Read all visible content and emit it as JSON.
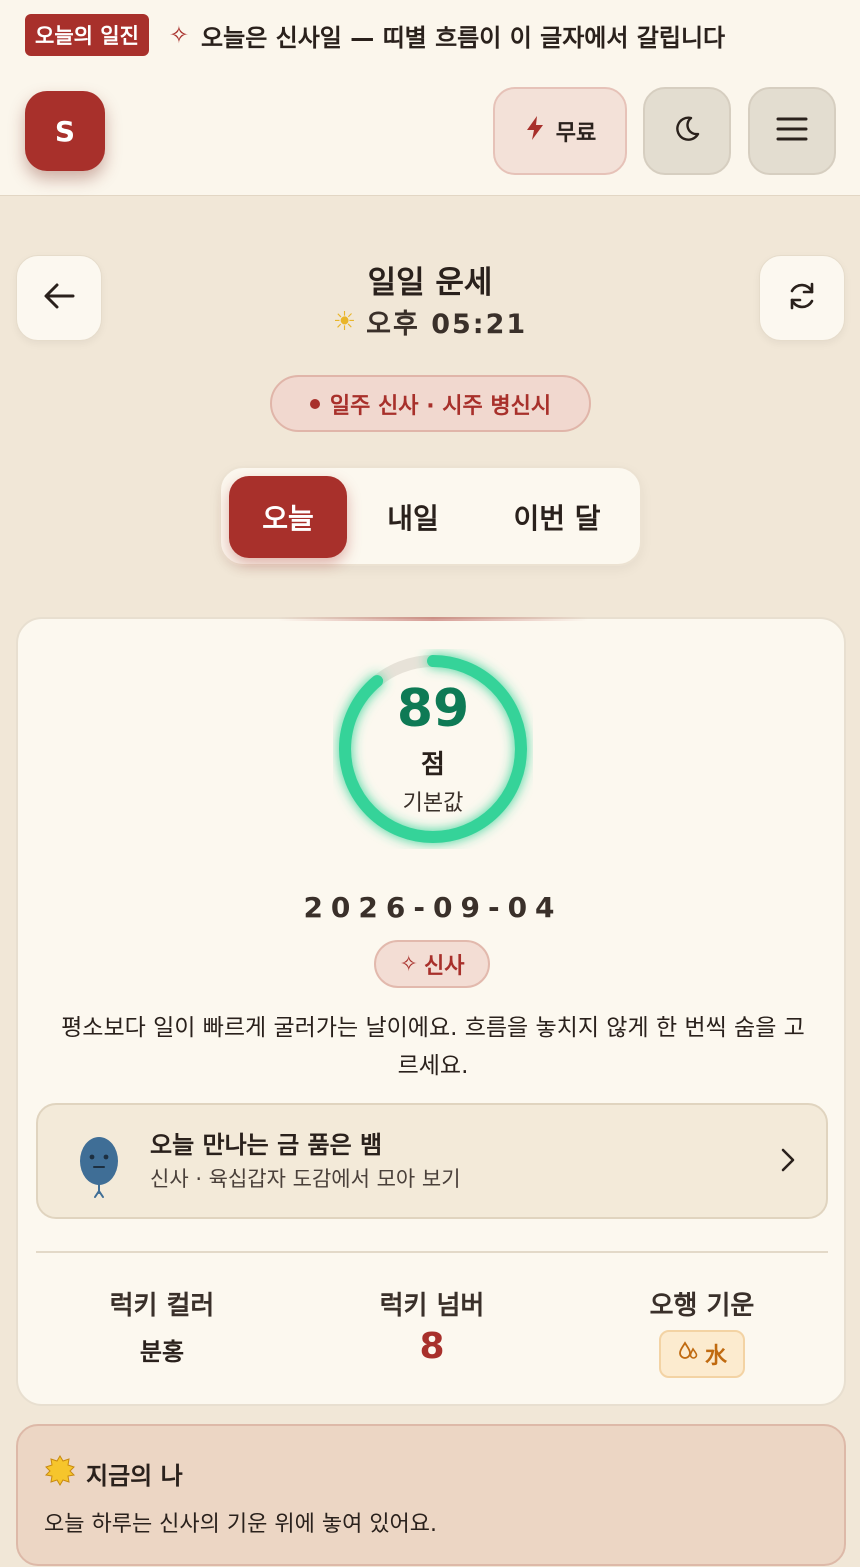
{
  "ticker": {
    "badge": "오늘의 일진",
    "icon": "sparkle-icon",
    "text": "오늘은 신사일 — 띠별 흐름이 이 글자에서 갈립니다"
  },
  "header": {
    "logo": "S",
    "free_label": "무료",
    "free_icon": "bolt-icon",
    "theme_icon": "moon-icon",
    "menu_icon": "hamburger-menu-icon"
  },
  "page": {
    "title": "일일 운세",
    "time": "오후 05:21",
    "time_icon": "sun-icon"
  },
  "pillar_badge": "일주 신사 · 시주 병신시",
  "tabs": [
    {
      "label": "오늘",
      "active": true
    },
    {
      "label": "내일",
      "active": false
    },
    {
      "label": "이번 달",
      "active": false
    }
  ],
  "score": {
    "value": "89",
    "unit": "점",
    "subtitle": "기본값",
    "percent": 89,
    "color": "#34d399"
  },
  "fortune": {
    "date": "2026-09-04",
    "ganji": "신사",
    "description": "평소보다 일이 빠르게 굴러가는 날이에요. 흐름을 놓치지 않게 한 번씩 숨을 고르세요."
  },
  "animal_card": {
    "title": "오늘 만나는 금 품은 뱀",
    "subtitle": "신사 · 육십갑자 도감에서 모아 보기"
  },
  "stats": {
    "color_label": "럭키 컬러",
    "color_value": "분홍",
    "number_label": "럭키 넘버",
    "number_value": "8",
    "element_label": "오행 기운",
    "element_value": "水",
    "element_icon": "water-drops-icon"
  },
  "now": {
    "title": "지금의 나",
    "icon": "sun-badge-icon",
    "text": "오늘 하루는 신사의 기운 위에 놓여 있어요."
  },
  "colors": {
    "accent": "#a8302b",
    "score_green": "#0e7a55",
    "element_orange": "#c06a10"
  }
}
